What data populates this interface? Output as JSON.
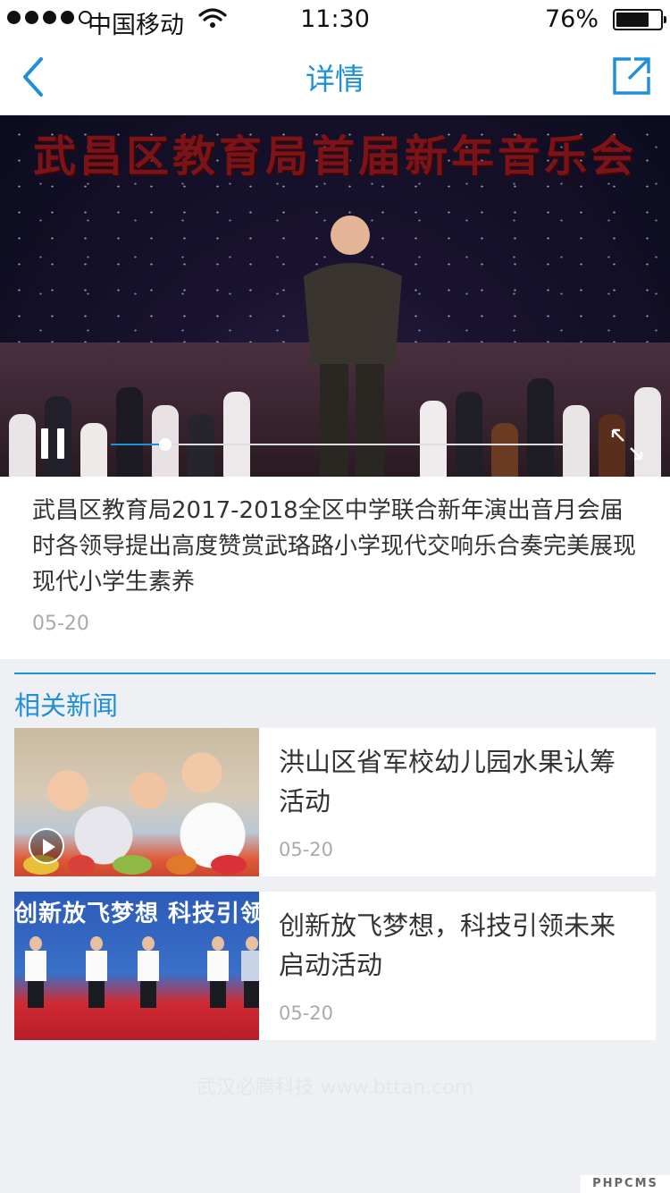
{
  "status_bar": {
    "carrier": "中国移动",
    "time": "11:30",
    "battery_percent": "76%",
    "battery_level": 0.76,
    "signal_bars_filled": 4,
    "signal_bars_total": 5
  },
  "nav": {
    "back_icon": "chevron-left-icon",
    "title": "详情",
    "share_icon": "share-icon",
    "accent_color": "#1e8fd8"
  },
  "video": {
    "banner_text": "武昌区教育局首届新年音乐会",
    "state": "playing",
    "progress": 0.12,
    "play_pause_icon": "pause-icon",
    "fullscreen_icon": "fullscreen-icon"
  },
  "article": {
    "title": "武昌区教育局2017-2018全区中学联合新年演出音月会届时各领导提出高度赞赏武珞路小学现代交响乐合奏完美展现现代小学生素养",
    "date": "05-20"
  },
  "related": {
    "heading": "相关新闻",
    "items": [
      {
        "title": "洪山区省军校幼儿园水果认筹活动",
        "date": "05-20",
        "has_video": true
      },
      {
        "title": "创新放飞梦想，科技引领未来启动活动",
        "date": "05-20",
        "has_video": false,
        "thumb_text": "创新放飞梦想 科技引领"
      }
    ]
  },
  "footer": {
    "watermark": "武汉必腾科技 www.bttan.com",
    "corner_badge": "PHPCMS"
  }
}
